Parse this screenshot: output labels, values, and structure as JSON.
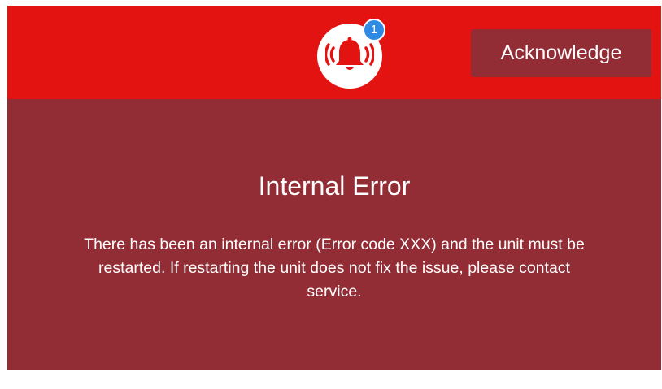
{
  "alert": {
    "acknowledge_label": "Acknowledge",
    "notification_count": "1",
    "title": "Internal Error",
    "message": "There has been an internal error (Error code XXX) and the unit must be restarted. If restarting the unit does not fix the issue, please contact service."
  },
  "icons": {
    "alarm": "alarm-bell-icon"
  },
  "colors": {
    "header": "#e31312",
    "panel": "#922d35",
    "badge": "#2f8ae6",
    "text": "#ffffff"
  }
}
